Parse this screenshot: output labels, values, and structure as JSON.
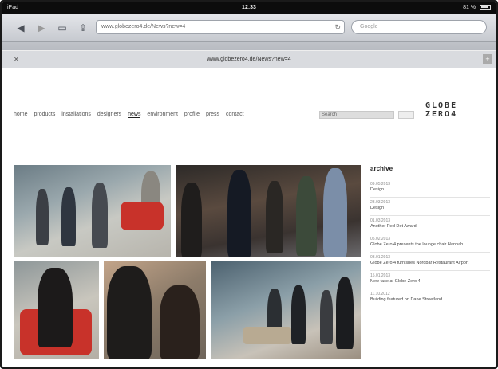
{
  "status_bar": {
    "carrier": "iPad",
    "time": "12:33",
    "battery": "81 %"
  },
  "browser": {
    "url": "www.globezero4.de/News?new=4",
    "search_placeholder": "Google",
    "tab_title": "www.globezero4.de/News?new=4",
    "icons": [
      "back-icon",
      "forward-icon",
      "bookmarks-icon",
      "share-icon",
      "reload-icon",
      "close-tab-icon",
      "new-tab-icon"
    ]
  },
  "site": {
    "logo_line1": "GLOBE",
    "logo_line2": "ZERO4",
    "nav": [
      "home",
      "products",
      "installations",
      "designers",
      "news",
      "environment",
      "profile",
      "press",
      "contact"
    ],
    "active_nav": "news",
    "search_value": "Search",
    "archive": {
      "heading": "archive",
      "items": [
        {
          "date": "09.05.2013",
          "title": "Design"
        },
        {
          "date": "23.03.2013",
          "title": "Design"
        },
        {
          "date": "01.03.2013",
          "title": "Another Red Dot Award"
        },
        {
          "date": "05.02.2013",
          "title": "Globe Zero 4 presents the lounge chair Hannah"
        },
        {
          "date": "03.01.2013",
          "title": "Globe Zero 4 furnishes Nordbar Restaurant Airport"
        },
        {
          "date": "15.01.2013",
          "title": "New face at Globe Zero 4"
        },
        {
          "date": "11.10.2012",
          "title": "Building featured on Dane Streetland"
        }
      ]
    }
  },
  "colors": {
    "accent_red": "#c8322a",
    "chrome_gray": "#c6c9cf"
  }
}
